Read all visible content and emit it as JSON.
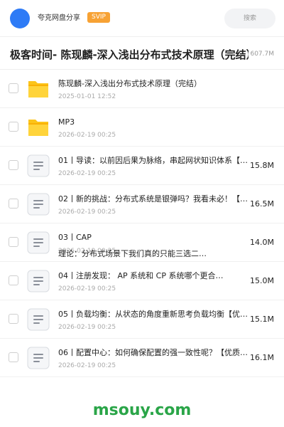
{
  "header": {
    "username": "夸克网盘分享",
    "vip_label": "SVIP",
    "search_placeholder": "搜索"
  },
  "folder": {
    "title": "极客时间- 陈现麟-深入浅出分布式技术原理（完结）",
    "total_size": "607.7M"
  },
  "files": [
    {
      "name": "陈现麟-深入浅出分布式技术原理（完结）",
      "date": "2025-01-01 12:52",
      "size": "",
      "type": "folder"
    },
    {
      "name": "MP3",
      "date": "2026-02-19 00:25",
      "size": "",
      "type": "folder"
    },
    {
      "name": "01丨导读：以前因后果为脉络，串起网状知识体系【手…",
      "date": "2026-02-19 00:25",
      "size": "15.8M",
      "type": "document"
    },
    {
      "name": "02丨新的挑战：分布式系统是银弹吗？我看未必！【更…",
      "date": "2026-02-19 00:25",
      "size": "16.5M",
      "type": "document"
    },
    {
      "name": "03丨CAP",
      "name_line2": "理论：分布式场景下我们真的只能三选二…",
      "date": "2026-02-19 00:25",
      "size": "14.0M",
      "type": "document"
    },
    {
      "name": "04丨注册发现： AP 系统和 CP 系统哪个更合…",
      "date": "2026-02-19 00:25",
      "size": "15.0M",
      "type": "document"
    },
    {
      "name": "05丨负载均衡：从状态的角度重新思考负载均衡【优质…",
      "date": "2026-02-19 00:25",
      "size": "15.1M",
      "type": "document"
    },
    {
      "name": "06丨配置中心：如何确保配置的强一致性呢？【优质合…",
      "date": "2026-02-19 00:25",
      "size": "16.1M",
      "type": "document"
    }
  ],
  "watermark": "msouy.com",
  "colors": {
    "accent": "#2e7bf6",
    "vip": "#f7a234",
    "folder": "#fcc419",
    "watermark": "#2aa548"
  }
}
